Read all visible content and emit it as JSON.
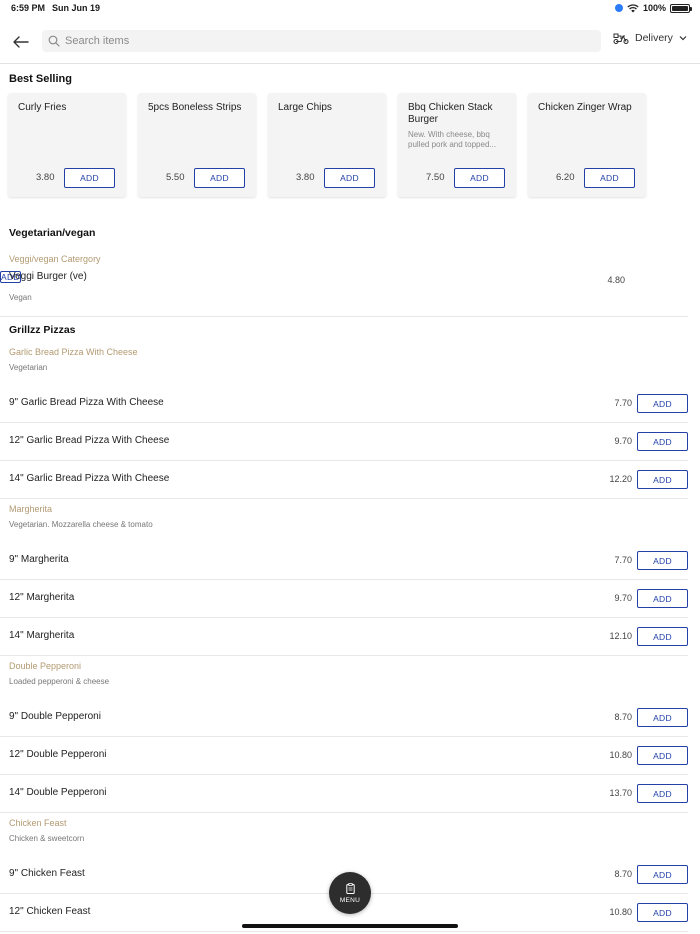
{
  "status_bar": {
    "time": "6:59 PM",
    "date": "Sun Jun 19",
    "battery": "100%"
  },
  "header": {
    "search_placeholder": "Search items",
    "delivery_label": "Delivery"
  },
  "best_selling": {
    "title": "Best Selling",
    "cards": [
      {
        "name": "Curly Fries",
        "desc": "",
        "price": "3.80",
        "add": "ADD"
      },
      {
        "name": "5pcs Boneless Strips",
        "desc": "",
        "price": "5.50",
        "add": "ADD"
      },
      {
        "name": "Large Chips",
        "desc": "",
        "price": "3.80",
        "add": "ADD"
      },
      {
        "name": "Bbq Chicken Stack Burger",
        "desc": "New. With cheese, bbq pulled pork and topped...",
        "price": "7.50",
        "add": "ADD"
      },
      {
        "name": "Chicken Zinger Wrap",
        "desc": "",
        "price": "6.20",
        "add": "ADD"
      }
    ]
  },
  "vegetarian": {
    "heading": "Vegetarian/vegan",
    "sub_title": "Veggi/vegan Catergory",
    "item": {
      "name": "Veggi Burger (ve)",
      "tag": "Vegan",
      "price": "4.80",
      "add": "ADD"
    }
  },
  "pizzas": {
    "heading": "Grillzz Pizzas",
    "groups": [
      {
        "title": "Garlic Bread Pizza With Cheese",
        "desc": "Vegetarian",
        "items": [
          {
            "name": "9\" Garlic Bread Pizza With Cheese",
            "price": "7.70",
            "add": "ADD"
          },
          {
            "name": "12\" Garlic Bread Pizza With Cheese",
            "price": "9.70",
            "add": "ADD"
          },
          {
            "name": "14\" Garlic Bread Pizza With Cheese",
            "price": "12.20",
            "add": "ADD"
          }
        ]
      },
      {
        "title": "Margherita",
        "desc": "Vegetarian. Mozzarella cheese & tomato",
        "items": [
          {
            "name": "9\" Margherita",
            "price": "7.70",
            "add": "ADD"
          },
          {
            "name": "12\" Margherita",
            "price": "9.70",
            "add": "ADD"
          },
          {
            "name": "14\" Margherita",
            "price": "12.10",
            "add": "ADD"
          }
        ]
      },
      {
        "title": "Double Pepperoni",
        "desc": "Loaded pepperoni & cheese",
        "items": [
          {
            "name": "9\" Double Pepperoni",
            "price": "8.70",
            "add": "ADD"
          },
          {
            "name": "12\" Double Pepperoni",
            "price": "10.80",
            "add": "ADD"
          },
          {
            "name": "14\" Double Pepperoni",
            "price": "13.70",
            "add": "ADD"
          }
        ]
      },
      {
        "title": "Chicken Feast",
        "desc": "Chicken & sweetcorn",
        "items": [
          {
            "name": "9\" Chicken Feast",
            "price": "8.70",
            "add": "ADD"
          },
          {
            "name": "12\" Chicken Feast",
            "price": "10.80",
            "add": "ADD"
          }
        ]
      }
    ]
  },
  "menu_button": {
    "label": "MENU"
  },
  "colors": {
    "accent": "#2340a8",
    "category_gold": "#b39a72",
    "fab": "#2d2d2d"
  }
}
